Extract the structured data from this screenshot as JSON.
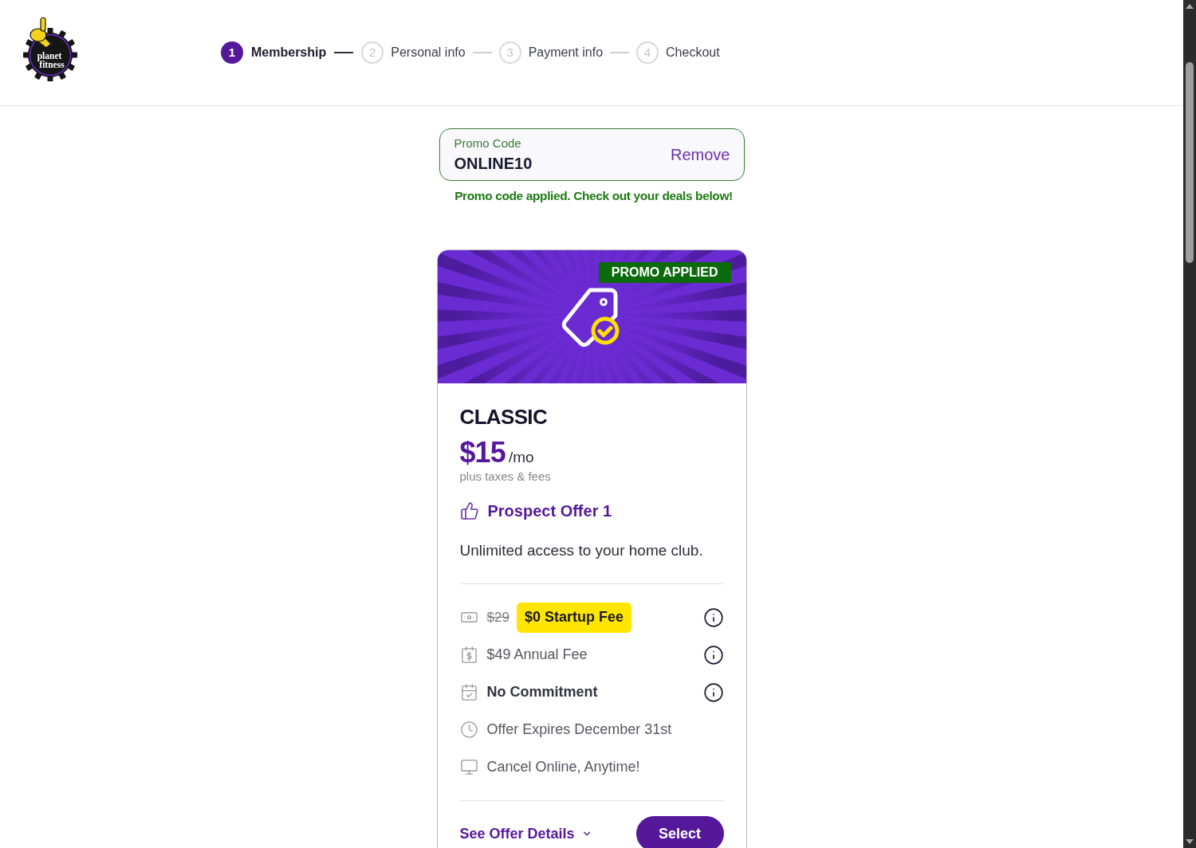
{
  "header": {
    "logo": {
      "lines": [
        "planet",
        "fitness"
      ]
    },
    "steps": [
      {
        "number": "1",
        "label": "Membership",
        "selected": true
      },
      {
        "number": "2",
        "label": "Personal info",
        "selected": false
      },
      {
        "number": "3",
        "label": "Payment info",
        "selected": false
      },
      {
        "number": "4",
        "label": "Checkout",
        "selected": false
      }
    ]
  },
  "promo": {
    "label": "Promo Code",
    "value": "ONLINE10",
    "action": "Remove",
    "message": "Promo code applied. Check out your deals below!"
  },
  "plan_card": {
    "badge": "PROMO APPLIED",
    "name": "CLASSIC",
    "price": "$15",
    "period": "/mo",
    "price_note": "plus taxes & fees",
    "offer": "Prospect Offer 1",
    "description": "Unlimited access to your home club.",
    "features": [
      {
        "kind": "startup",
        "old_price": "$29",
        "text": "$0 Startup Fee",
        "highlight": true,
        "bold": false,
        "info": true
      },
      {
        "kind": "annual",
        "text": "$49 Annual Fee",
        "highlight": false,
        "bold": false,
        "info": true
      },
      {
        "kind": "commitment",
        "text": "No Commitment",
        "highlight": false,
        "bold": true,
        "info": true
      },
      {
        "kind": "expiry",
        "text": "Offer Expires December 31st",
        "highlight": false,
        "bold": false,
        "info": false
      },
      {
        "kind": "cancel",
        "text": "Cancel Online, Anytime!",
        "highlight": false,
        "bold": false,
        "info": false
      }
    ],
    "details_link": "See Offer Details",
    "select_button": "Select"
  }
}
